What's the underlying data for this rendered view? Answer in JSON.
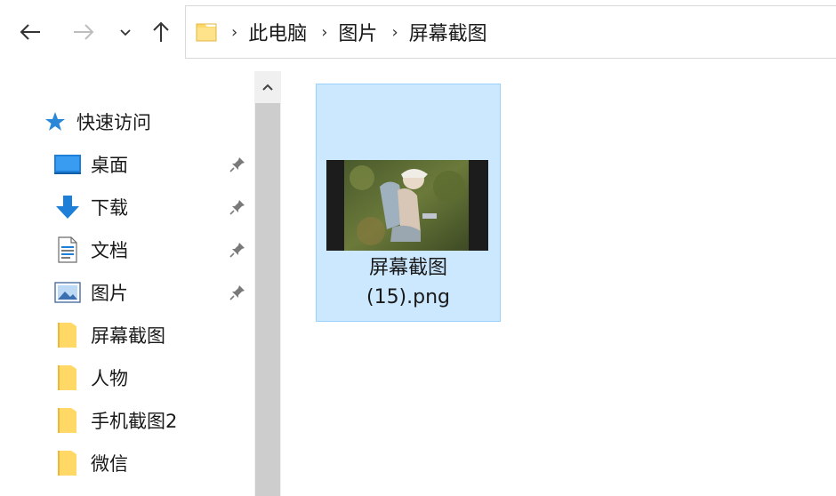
{
  "nav": {
    "back_icon": "arrow-left-icon",
    "forward_icon": "arrow-right-icon",
    "recent_icon": "chevron-down-icon",
    "up_icon": "arrow-up-icon"
  },
  "address": {
    "separator": "›",
    "crumbs": [
      "此电脑",
      "图片",
      "屏幕截图"
    ]
  },
  "sidebar": {
    "quick_access": "快速访问",
    "items": [
      {
        "label": "桌面",
        "icon": "desktop-icon",
        "pinned": true
      },
      {
        "label": "下载",
        "icon": "download-icon",
        "pinned": true
      },
      {
        "label": "文档",
        "icon": "document-icon",
        "pinned": true
      },
      {
        "label": "图片",
        "icon": "pictures-icon",
        "pinned": true
      },
      {
        "label": "屏幕截图",
        "icon": "folder-icon",
        "pinned": false
      },
      {
        "label": "人物",
        "icon": "folder-icon",
        "pinned": false
      },
      {
        "label": "手机截图2",
        "icon": "folder-icon",
        "pinned": false
      },
      {
        "label": "微信",
        "icon": "folder-icon",
        "pinned": false
      }
    ]
  },
  "content": {
    "files": [
      {
        "name_line1": "屏幕截图",
        "name_line2": "(15).png",
        "selected": true
      }
    ]
  },
  "colors": {
    "selection_bg": "#cce8ff",
    "selection_border": "#99d1ff",
    "folder_yellow": "#ffd866",
    "accent_blue": "#1e7fd8"
  }
}
